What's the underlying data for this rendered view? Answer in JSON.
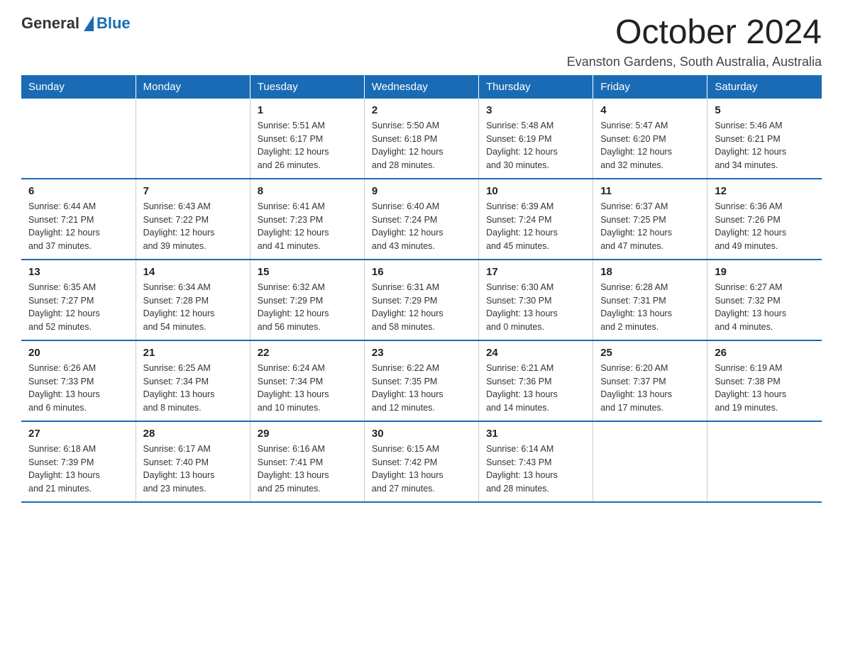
{
  "header": {
    "logo_general": "General",
    "logo_blue": "Blue",
    "month_year": "October 2024",
    "location": "Evanston Gardens, South Australia, Australia"
  },
  "weekdays": [
    "Sunday",
    "Monday",
    "Tuesday",
    "Wednesday",
    "Thursday",
    "Friday",
    "Saturday"
  ],
  "weeks": [
    [
      {
        "day": "",
        "info": ""
      },
      {
        "day": "",
        "info": ""
      },
      {
        "day": "1",
        "info": "Sunrise: 5:51 AM\nSunset: 6:17 PM\nDaylight: 12 hours\nand 26 minutes."
      },
      {
        "day": "2",
        "info": "Sunrise: 5:50 AM\nSunset: 6:18 PM\nDaylight: 12 hours\nand 28 minutes."
      },
      {
        "day": "3",
        "info": "Sunrise: 5:48 AM\nSunset: 6:19 PM\nDaylight: 12 hours\nand 30 minutes."
      },
      {
        "day": "4",
        "info": "Sunrise: 5:47 AM\nSunset: 6:20 PM\nDaylight: 12 hours\nand 32 minutes."
      },
      {
        "day": "5",
        "info": "Sunrise: 5:46 AM\nSunset: 6:21 PM\nDaylight: 12 hours\nand 34 minutes."
      }
    ],
    [
      {
        "day": "6",
        "info": "Sunrise: 6:44 AM\nSunset: 7:21 PM\nDaylight: 12 hours\nand 37 minutes."
      },
      {
        "day": "7",
        "info": "Sunrise: 6:43 AM\nSunset: 7:22 PM\nDaylight: 12 hours\nand 39 minutes."
      },
      {
        "day": "8",
        "info": "Sunrise: 6:41 AM\nSunset: 7:23 PM\nDaylight: 12 hours\nand 41 minutes."
      },
      {
        "day": "9",
        "info": "Sunrise: 6:40 AM\nSunset: 7:24 PM\nDaylight: 12 hours\nand 43 minutes."
      },
      {
        "day": "10",
        "info": "Sunrise: 6:39 AM\nSunset: 7:24 PM\nDaylight: 12 hours\nand 45 minutes."
      },
      {
        "day": "11",
        "info": "Sunrise: 6:37 AM\nSunset: 7:25 PM\nDaylight: 12 hours\nand 47 minutes."
      },
      {
        "day": "12",
        "info": "Sunrise: 6:36 AM\nSunset: 7:26 PM\nDaylight: 12 hours\nand 49 minutes."
      }
    ],
    [
      {
        "day": "13",
        "info": "Sunrise: 6:35 AM\nSunset: 7:27 PM\nDaylight: 12 hours\nand 52 minutes."
      },
      {
        "day": "14",
        "info": "Sunrise: 6:34 AM\nSunset: 7:28 PM\nDaylight: 12 hours\nand 54 minutes."
      },
      {
        "day": "15",
        "info": "Sunrise: 6:32 AM\nSunset: 7:29 PM\nDaylight: 12 hours\nand 56 minutes."
      },
      {
        "day": "16",
        "info": "Sunrise: 6:31 AM\nSunset: 7:29 PM\nDaylight: 12 hours\nand 58 minutes."
      },
      {
        "day": "17",
        "info": "Sunrise: 6:30 AM\nSunset: 7:30 PM\nDaylight: 13 hours\nand 0 minutes."
      },
      {
        "day": "18",
        "info": "Sunrise: 6:28 AM\nSunset: 7:31 PM\nDaylight: 13 hours\nand 2 minutes."
      },
      {
        "day": "19",
        "info": "Sunrise: 6:27 AM\nSunset: 7:32 PM\nDaylight: 13 hours\nand 4 minutes."
      }
    ],
    [
      {
        "day": "20",
        "info": "Sunrise: 6:26 AM\nSunset: 7:33 PM\nDaylight: 13 hours\nand 6 minutes."
      },
      {
        "day": "21",
        "info": "Sunrise: 6:25 AM\nSunset: 7:34 PM\nDaylight: 13 hours\nand 8 minutes."
      },
      {
        "day": "22",
        "info": "Sunrise: 6:24 AM\nSunset: 7:34 PM\nDaylight: 13 hours\nand 10 minutes."
      },
      {
        "day": "23",
        "info": "Sunrise: 6:22 AM\nSunset: 7:35 PM\nDaylight: 13 hours\nand 12 minutes."
      },
      {
        "day": "24",
        "info": "Sunrise: 6:21 AM\nSunset: 7:36 PM\nDaylight: 13 hours\nand 14 minutes."
      },
      {
        "day": "25",
        "info": "Sunrise: 6:20 AM\nSunset: 7:37 PM\nDaylight: 13 hours\nand 17 minutes."
      },
      {
        "day": "26",
        "info": "Sunrise: 6:19 AM\nSunset: 7:38 PM\nDaylight: 13 hours\nand 19 minutes."
      }
    ],
    [
      {
        "day": "27",
        "info": "Sunrise: 6:18 AM\nSunset: 7:39 PM\nDaylight: 13 hours\nand 21 minutes."
      },
      {
        "day": "28",
        "info": "Sunrise: 6:17 AM\nSunset: 7:40 PM\nDaylight: 13 hours\nand 23 minutes."
      },
      {
        "day": "29",
        "info": "Sunrise: 6:16 AM\nSunset: 7:41 PM\nDaylight: 13 hours\nand 25 minutes."
      },
      {
        "day": "30",
        "info": "Sunrise: 6:15 AM\nSunset: 7:42 PM\nDaylight: 13 hours\nand 27 minutes."
      },
      {
        "day": "31",
        "info": "Sunrise: 6:14 AM\nSunset: 7:43 PM\nDaylight: 13 hours\nand 28 minutes."
      },
      {
        "day": "",
        "info": ""
      },
      {
        "day": "",
        "info": ""
      }
    ]
  ]
}
